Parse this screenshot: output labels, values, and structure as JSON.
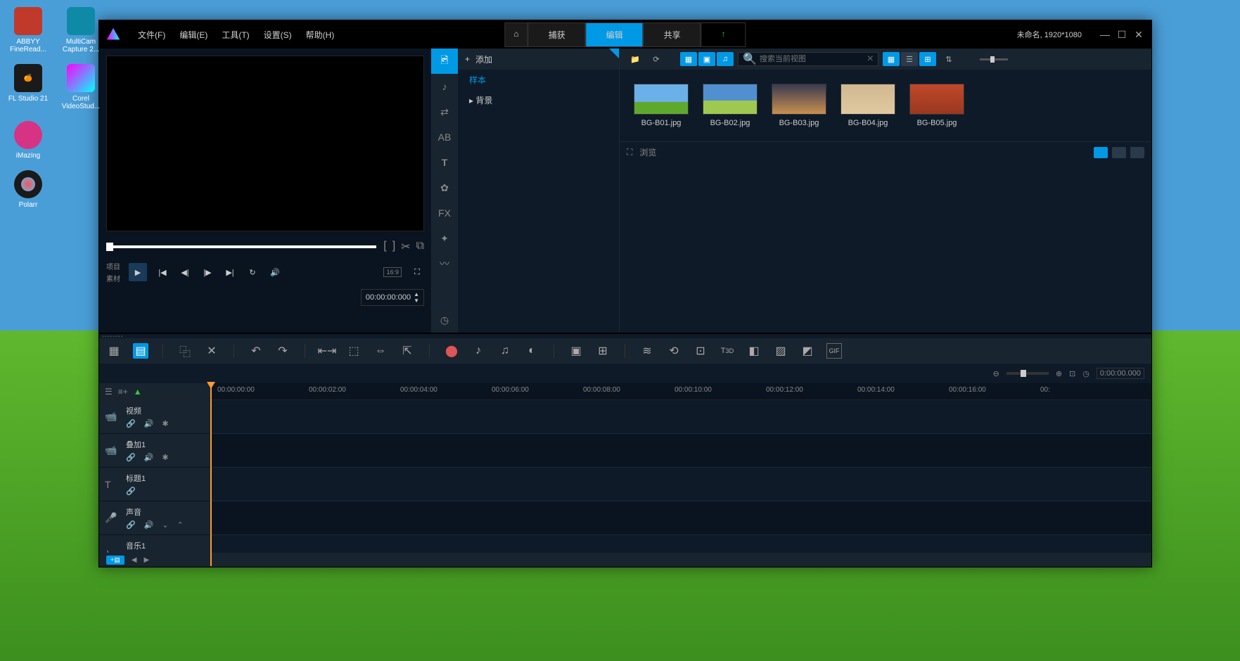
{
  "desktop": {
    "icons": [
      {
        "name": "ABBYY FineRead...",
        "color": "#c0392b"
      },
      {
        "name": "MultiCam Capture 2...",
        "color": "#0e8aa6"
      },
      {
        "name": "FL Studio 21",
        "color": "#1a1a1a"
      },
      {
        "name": "Corel VideoStud...",
        "color": "#1a1a1a"
      },
      {
        "name": "iMazing",
        "color": "#d63384"
      },
      {
        "name": "Polarr",
        "color": "#1a1a1a"
      }
    ]
  },
  "menu": {
    "file": "文件(F)",
    "edit": "编辑(E)",
    "tools": "工具(T)",
    "settings": "设置(S)",
    "help": "帮助(H)"
  },
  "modes": {
    "capture": "捕获",
    "edit": "编辑",
    "share": "共享"
  },
  "project_info": "未命名, 1920*1080",
  "preview": {
    "label_project": "项目",
    "label_source": "素材",
    "aspect": "16:9",
    "timecode": "00:00:00:000"
  },
  "library": {
    "add": "添加",
    "tree_root": "样本",
    "tree_child": "背景",
    "search_placeholder": "搜索当前视图",
    "browse": "浏览",
    "thumbs": [
      {
        "name": "BG-B01.jpg",
        "bg": "linear-gradient(#6bb0e8 60%, #5fa82e 60%)"
      },
      {
        "name": "BG-B02.jpg",
        "bg": "linear-gradient(#5090d0 55%, #9fc850 55%)"
      },
      {
        "name": "BG-B03.jpg",
        "bg": "linear-gradient(#3a3a50, #c89050)"
      },
      {
        "name": "BG-B04.jpg",
        "bg": "linear-gradient(#d0b890, #e0c8a0)"
      },
      {
        "name": "BG-B05.jpg",
        "bg": "linear-gradient(#c0482a, #9a3820)"
      }
    ]
  },
  "timeline": {
    "zoom_time": "0:00:00.000",
    "ruler": [
      "00:00:00:00",
      "00:00:02:00",
      "00:00:04:00",
      "00:00:06:00",
      "00:00:08:00",
      "00:00:10:00",
      "00:00:12:00",
      "00:00:14:00",
      "00:00:16:00",
      "00:"
    ],
    "tracks": [
      {
        "name": "视频",
        "icon": "video"
      },
      {
        "name": "叠加1",
        "icon": "overlay"
      },
      {
        "name": "标题1",
        "icon": "title"
      },
      {
        "name": "声音",
        "icon": "voice"
      },
      {
        "name": "音乐1",
        "icon": "music"
      }
    ]
  }
}
